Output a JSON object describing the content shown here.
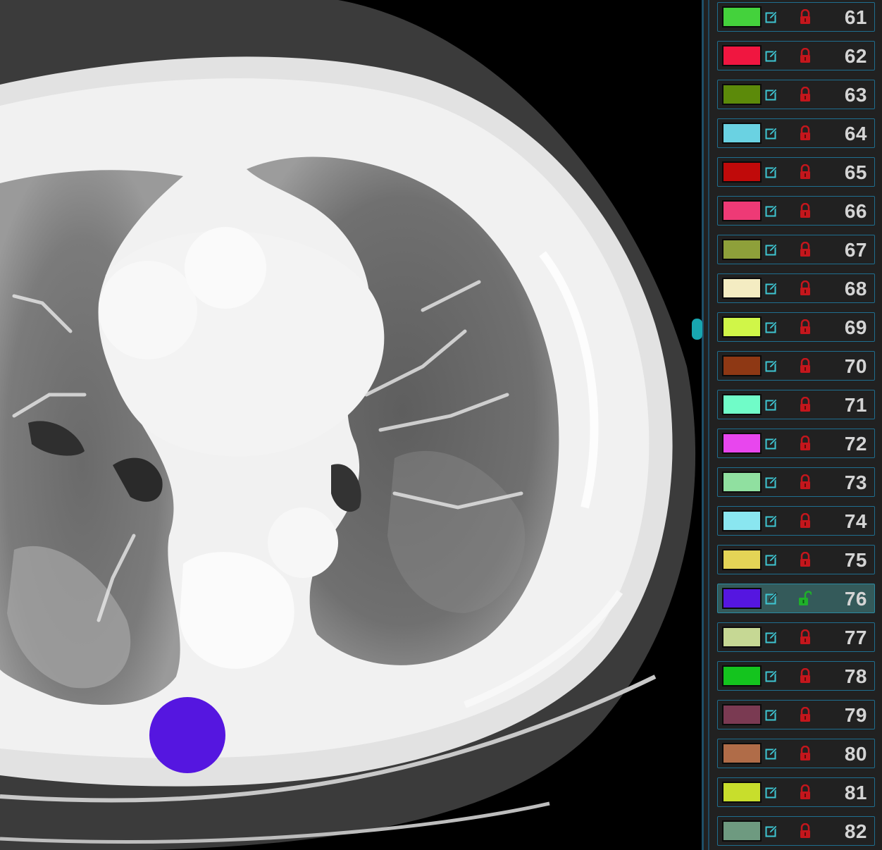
{
  "viewer": {
    "segment_marker_color": "#5516e0"
  },
  "segments": [
    {
      "number": "61",
      "color": "#44d23c",
      "locked": true
    },
    {
      "number": "62",
      "color": "#f01640",
      "locked": true
    },
    {
      "number": "63",
      "color": "#5c8a0a",
      "locked": true
    },
    {
      "number": "64",
      "color": "#6ad2e2",
      "locked": true
    },
    {
      "number": "65",
      "color": "#c00a0a",
      "locked": true
    },
    {
      "number": "66",
      "color": "#ee3a76",
      "locked": true
    },
    {
      "number": "67",
      "color": "#8ea03a",
      "locked": true
    },
    {
      "number": "68",
      "color": "#f4ecc2",
      "locked": true
    },
    {
      "number": "69",
      "color": "#d0f648",
      "locked": true
    },
    {
      "number": "70",
      "color": "#8e3814",
      "locked": true
    },
    {
      "number": "71",
      "color": "#70fcc8",
      "locked": true
    },
    {
      "number": "72",
      "color": "#e846ee",
      "locked": true
    },
    {
      "number": "73",
      "color": "#90e0a0",
      "locked": true
    },
    {
      "number": "74",
      "color": "#8ae6f0",
      "locked": true
    },
    {
      "number": "75",
      "color": "#e4d456",
      "locked": true
    },
    {
      "number": "76",
      "color": "#5516e0",
      "locked": false
    },
    {
      "number": "77",
      "color": "#c6d894",
      "locked": true
    },
    {
      "number": "78",
      "color": "#14c41e",
      "locked": true
    },
    {
      "number": "79",
      "color": "#7a3a52",
      "locked": true
    },
    {
      "number": "80",
      "color": "#b06c48",
      "locked": true
    },
    {
      "number": "81",
      "color": "#c8de2c",
      "locked": true
    },
    {
      "number": "82",
      "color": "#6e9a80",
      "locked": true
    }
  ],
  "active_segment": "76",
  "icons": {
    "edit": "edit-pencil-icon",
    "lock": "lock-icon",
    "unlock": "unlock-icon"
  }
}
